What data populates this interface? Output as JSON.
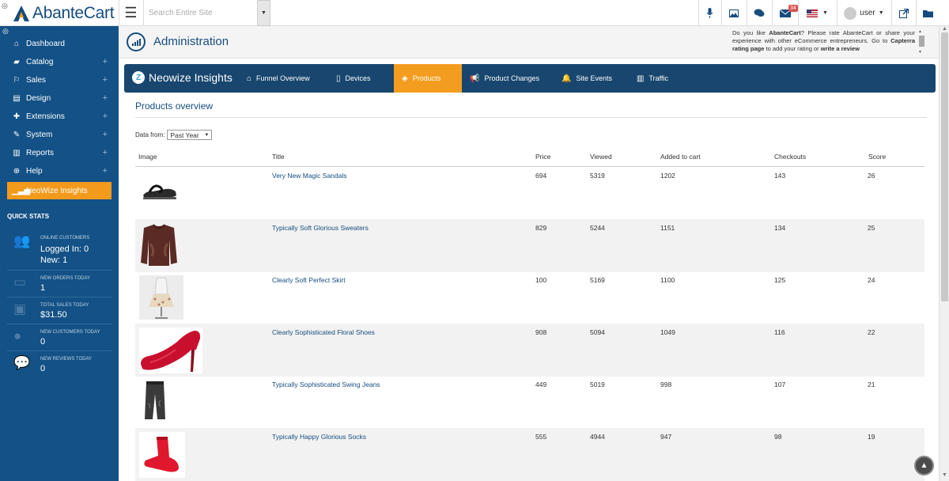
{
  "app": {
    "logo_text": "AbanteCart"
  },
  "topbar": {
    "search_placeholder": "Search Entire Site",
    "messages_badge": "34",
    "user_label": "user"
  },
  "sidebar": {
    "items": [
      {
        "label": "Dashboard",
        "icon": "home-icon",
        "expandable": false
      },
      {
        "label": "Catalog",
        "icon": "folder-open-icon",
        "expandable": true
      },
      {
        "label": "Sales",
        "icon": "flag-icon",
        "expandable": true
      },
      {
        "label": "Design",
        "icon": "file-icon",
        "expandable": true
      },
      {
        "label": "Extensions",
        "icon": "puzzle-icon",
        "expandable": true
      },
      {
        "label": "System",
        "icon": "wrench-icon",
        "expandable": true
      },
      {
        "label": "Reports",
        "icon": "bar-chart-icon",
        "expandable": true
      },
      {
        "label": "Help",
        "icon": "globe-icon",
        "expandable": true
      },
      {
        "label": "NeoWize Insights",
        "icon": "signal-icon",
        "expandable": false
      }
    ],
    "quick_stats_title": "QUICK STATS",
    "quick_stats": [
      {
        "label": "ONLINE CUSTOMERS",
        "value": "Logged In: 0",
        "value2": "New: 1",
        "icon": "users-icon"
      },
      {
        "label": "NEW ORDERS TODAY",
        "value": "1",
        "icon": "credit-card-icon"
      },
      {
        "label": "TOTAL SALES TODAY",
        "value": "$31.50",
        "icon": "money-icon"
      },
      {
        "label": "NEW CUSTOMERS TODAY",
        "value": "0",
        "icon": "user-icon"
      },
      {
        "label": "NEW REVIEWS TODAY",
        "value": "0",
        "icon": "comment-icon"
      }
    ]
  },
  "header": {
    "title": "Administration",
    "rate_text_1": "Do you like ",
    "rate_brand": "AbanteCart",
    "rate_text_2": "? Please rate AbanteCart or share your experience with other eCommerce entrepreneurs. Go to ",
    "rate_link1": "Capterra rating page",
    "rate_text_3": " to add your rating or ",
    "rate_link2": "write a review"
  },
  "neowize": {
    "title": "Neowize Insights",
    "tabs": [
      {
        "label": "Funnel Overview",
        "icon": "home-icon"
      },
      {
        "label": "Devices",
        "icon": "tablet-icon"
      },
      {
        "label": "Products",
        "icon": "cube-icon"
      },
      {
        "label": "Product Changes",
        "icon": "bullhorn-icon"
      },
      {
        "label": "Site Events",
        "icon": "bell-icon"
      },
      {
        "label": "Traffic",
        "icon": "bar-chart-icon"
      }
    ],
    "active_tab": "Products"
  },
  "products": {
    "title": "Products overview",
    "data_from_label": "Data from:",
    "data_from_value": "Past Year",
    "columns": [
      "Image",
      "Title",
      "Price",
      "Viewed",
      "Added to cart",
      "Checkouts",
      "Score"
    ],
    "rows": [
      {
        "title": "Very New Magic Sandals",
        "price": "694",
        "viewed": "5319",
        "added": "1202",
        "checkouts": "143",
        "score": "26",
        "image": "sandal"
      },
      {
        "title": "Typically Soft Glorious Sweaters",
        "price": "829",
        "viewed": "5244",
        "added": "1151",
        "checkouts": "134",
        "score": "25",
        "image": "sweater"
      },
      {
        "title": "Clearly Soft Perfect Skirt",
        "price": "100",
        "viewed": "5169",
        "added": "1100",
        "checkouts": "125",
        "score": "24",
        "image": "skirt"
      },
      {
        "title": "Clearly Sophisticated Floral Shoes",
        "price": "908",
        "viewed": "5094",
        "added": "1049",
        "checkouts": "116",
        "score": "22",
        "image": "heels"
      },
      {
        "title": "Typically Sophisticated Swing Jeans",
        "price": "449",
        "viewed": "5019",
        "added": "998",
        "checkouts": "107",
        "score": "21",
        "image": "jeans"
      },
      {
        "title": "Typically Happy Glorious Socks",
        "price": "555",
        "viewed": "4944",
        "added": "947",
        "checkouts": "98",
        "score": "19",
        "image": "socks"
      }
    ]
  },
  "colors": {
    "sidebar": "#135186",
    "accent": "#f39d20",
    "nwbar": "#18466e",
    "link": "#164c7e"
  }
}
